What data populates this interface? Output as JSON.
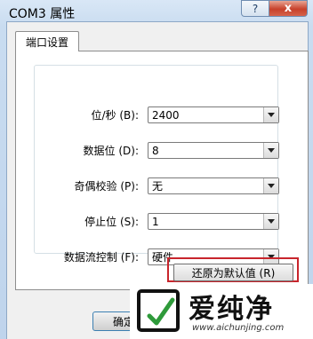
{
  "window": {
    "title": "COM3 属性",
    "help_label": "?",
    "close_label": "x"
  },
  "tabs": [
    {
      "label": "端口设置"
    }
  ],
  "settings": [
    {
      "label": "位/秒 (B):",
      "value": "2400"
    },
    {
      "label": "数据位 (D):",
      "value": "8"
    },
    {
      "label": "奇偶校验 (P):",
      "value": "无"
    },
    {
      "label": "停止位 (S):",
      "value": "1"
    },
    {
      "label": "数据流控制 (F):",
      "value": "硬件"
    }
  ],
  "buttons": {
    "restore_defaults": "还原为默认值 (R)",
    "ok": "确定"
  },
  "colors": {
    "highlight": "#c8252c",
    "close": "#c7412b"
  },
  "watermark": {
    "text": "爱纯净",
    "url": "www.aichunjing.com"
  }
}
